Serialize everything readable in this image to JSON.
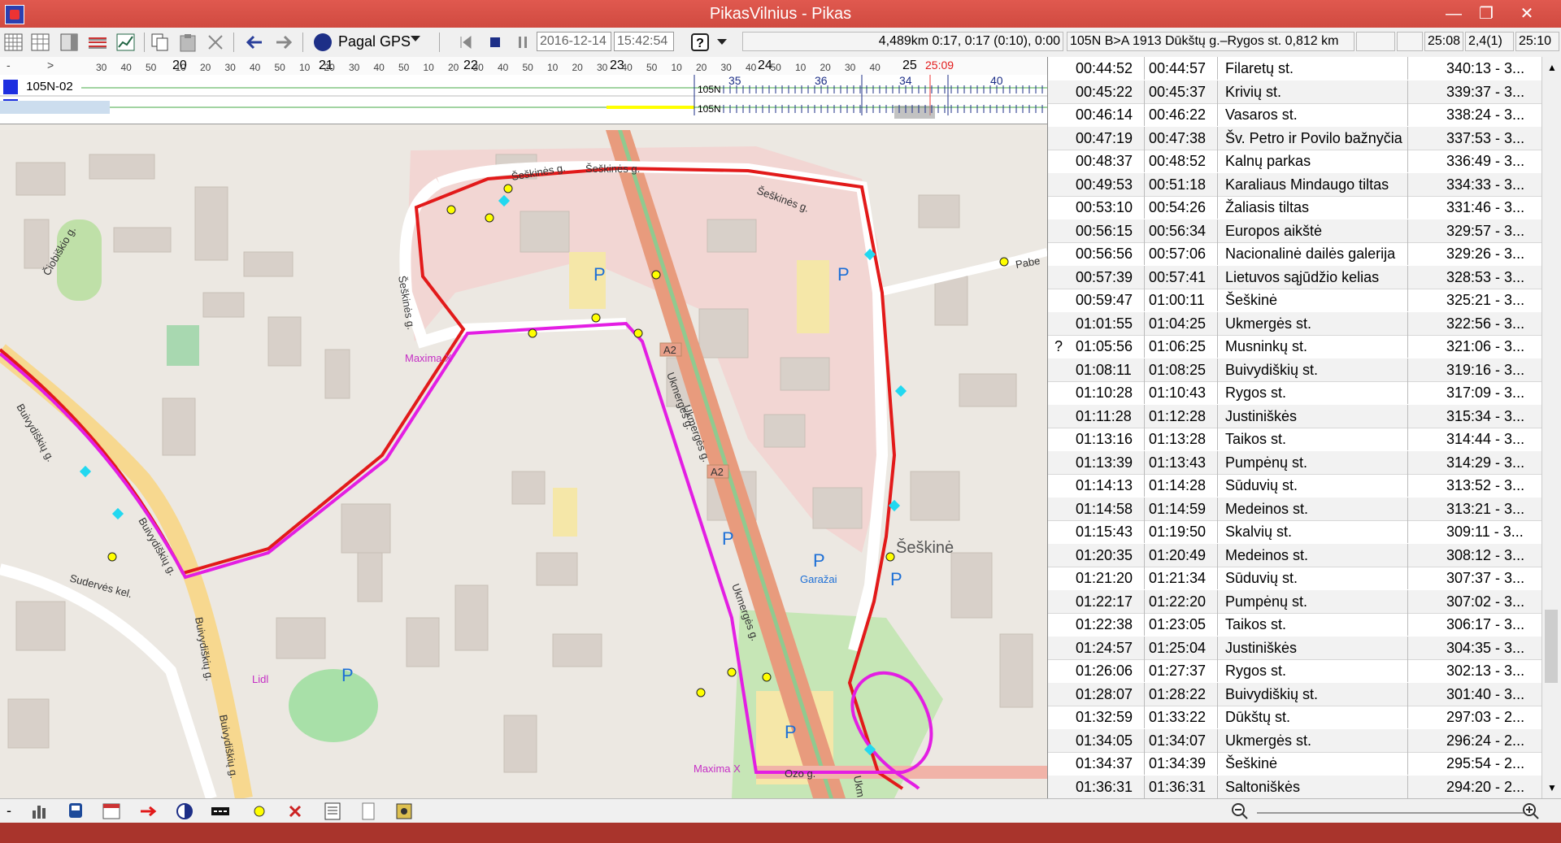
{
  "window": {
    "title": "PikasVilnius - Pikas"
  },
  "toolbar": {
    "gps_label": "Pagal GPS",
    "date": "2016-12-14",
    "time": "15:42:54",
    "status_distance": "4,489km 0:17, 0:17 (0:10), 0:00",
    "status_route": "105N B>A 1913 Dūkštų g.–Rygos st. 0,812 km",
    "status_time1": "25:08",
    "status_value": "2,4(1)",
    "status_time2": "25:10"
  },
  "ruler": {
    "left_minus": "-",
    "left_arrow": ">",
    "hour_labels": [
      "20",
      "21",
      "22",
      "23",
      "24",
      "25"
    ],
    "minute_labels": [
      "30",
      "40",
      "50",
      "10",
      "20",
      "30",
      "40",
      "50",
      "10",
      "20",
      "30",
      "40",
      "50",
      "10",
      "20",
      "30",
      "40",
      "50",
      "10",
      "20",
      "30",
      "40",
      "50",
      "10",
      "20",
      "30",
      "40",
      "50",
      "10",
      "20",
      "30",
      "40"
    ],
    "current_time": "25:09"
  },
  "tracks": {
    "rows": [
      {
        "label": "105N-02",
        "tag": "105N"
      },
      {
        "label": "02",
        "tag": "105N"
      }
    ],
    "seg_labels": [
      "35",
      "36",
      "34",
      "40"
    ]
  },
  "map": {
    "streets": [
      "Šeškinės g.",
      "Šeškinės g.",
      "Šeškinės g.",
      "Šeškinės g.",
      "Ukmergės g.",
      "Ukmergės g.",
      "Ukmergės g.",
      "Buivydiškių g.",
      "Buivydiškių g.",
      "Buivydiškių g.",
      "Buivydiškių g.",
      "Sudervės kel.",
      "Čiobiškio g.",
      "Pabe",
      "Ozo g.",
      "Ukm"
    ],
    "road_badges": [
      "A2",
      "A2"
    ],
    "places": [
      "Maxima X",
      "Lidl",
      "Maxima X",
      "Garažai",
      "Šeškinė"
    ],
    "parking": "P",
    "colors": {
      "route_red": "#e21a1a",
      "route_magenta": "#e31ee3",
      "park_green": "#c8e6b4",
      "residential": "#f1d4d2"
    }
  },
  "table": {
    "rows": [
      {
        "flag": "",
        "arr": "00:44:52",
        "dep": "00:44:57",
        "stop": "Filaretų st.",
        "val": "340:13 - 3..."
      },
      {
        "flag": "",
        "arr": "00:45:22",
        "dep": "00:45:37",
        "stop": "Krivių st.",
        "val": "339:37 - 3..."
      },
      {
        "flag": "",
        "arr": "00:46:14",
        "dep": "00:46:22",
        "stop": "Vasaros st.",
        "val": "338:24 - 3..."
      },
      {
        "flag": "",
        "arr": "00:47:19",
        "dep": "00:47:38",
        "stop": "Šv. Petro ir Povilo bažnyčia",
        "val": "337:53 - 3..."
      },
      {
        "flag": "",
        "arr": "00:48:37",
        "dep": "00:48:52",
        "stop": "Kalnų parkas",
        "val": "336:49 - 3..."
      },
      {
        "flag": "",
        "arr": "00:49:53",
        "dep": "00:51:18",
        "stop": "Karaliaus Mindaugo tiltas",
        "val": "334:33 - 3..."
      },
      {
        "flag": "",
        "arr": "00:53:10",
        "dep": "00:54:26",
        "stop": "Žaliasis tiltas",
        "val": "331:46 - 3..."
      },
      {
        "flag": "",
        "arr": "00:56:15",
        "dep": "00:56:34",
        "stop": "Europos aikštė",
        "val": "329:57 - 3..."
      },
      {
        "flag": "",
        "arr": "00:56:56",
        "dep": "00:57:06",
        "stop": "Nacionalinė dailės galerija",
        "val": "329:26 - 3..."
      },
      {
        "flag": "",
        "arr": "00:57:39",
        "dep": "00:57:41",
        "stop": "Lietuvos sąjūdžio kelias",
        "val": "328:53 - 3..."
      },
      {
        "flag": "",
        "arr": "00:59:47",
        "dep": "01:00:11",
        "stop": "Šeškinė",
        "val": "325:21 - 3..."
      },
      {
        "flag": "",
        "arr": "01:01:55",
        "dep": "01:04:25",
        "stop": "Ukmergės st.",
        "val": "322:56 - 3..."
      },
      {
        "flag": "?",
        "arr": "01:05:56",
        "dep": "01:06:25",
        "stop": "Musninkų st.",
        "val": "321:06 - 3..."
      },
      {
        "flag": "",
        "arr": "01:08:11",
        "dep": "01:08:25",
        "stop": "Buivydiškių st.",
        "val": "319:16 - 3..."
      },
      {
        "flag": "",
        "arr": "01:10:28",
        "dep": "01:10:43",
        "stop": "Rygos st.",
        "val": "317:09 - 3..."
      },
      {
        "flag": "",
        "arr": "01:11:28",
        "dep": "01:12:28",
        "stop": "Justiniškės",
        "val": "315:34 - 3..."
      },
      {
        "flag": "",
        "arr": "01:13:16",
        "dep": "01:13:28",
        "stop": "Taikos st.",
        "val": "314:44 - 3..."
      },
      {
        "flag": "",
        "arr": "01:13:39",
        "dep": "01:13:43",
        "stop": "Pumpėnų st.",
        "val": "314:29 - 3..."
      },
      {
        "flag": "",
        "arr": "01:14:13",
        "dep": "01:14:28",
        "stop": "Sūduvių st.",
        "val": "313:52 - 3..."
      },
      {
        "flag": "",
        "arr": "01:14:58",
        "dep": "01:14:59",
        "stop": "Medeinos st.",
        "val": "313:21 - 3..."
      },
      {
        "flag": "",
        "arr": "01:15:43",
        "dep": "01:19:50",
        "stop": "Skalvių st.",
        "val": "309:11 - 3..."
      },
      {
        "flag": "",
        "arr": "01:20:35",
        "dep": "01:20:49",
        "stop": "Medeinos st.",
        "val": "308:12 - 3..."
      },
      {
        "flag": "",
        "arr": "01:21:20",
        "dep": "01:21:34",
        "stop": "Sūduvių st.",
        "val": "307:37 - 3..."
      },
      {
        "flag": "",
        "arr": "01:22:17",
        "dep": "01:22:20",
        "stop": "Pumpėnų st.",
        "val": "307:02 - 3..."
      },
      {
        "flag": "",
        "arr": "01:22:38",
        "dep": "01:23:05",
        "stop": "Taikos st.",
        "val": "306:17 - 3..."
      },
      {
        "flag": "",
        "arr": "01:24:57",
        "dep": "01:25:04",
        "stop": "Justiniškės",
        "val": "304:35 - 3..."
      },
      {
        "flag": "",
        "arr": "01:26:06",
        "dep": "01:27:37",
        "stop": "Rygos st.",
        "val": "302:13 - 3..."
      },
      {
        "flag": "",
        "arr": "01:28:07",
        "dep": "01:28:22",
        "stop": "Buivydiškių st.",
        "val": "301:40 - 3..."
      },
      {
        "flag": "",
        "arr": "01:32:59",
        "dep": "01:33:22",
        "stop": "Dūkštų st.",
        "val": "297:03 - 2..."
      },
      {
        "flag": "",
        "arr": "01:34:05",
        "dep": "01:34:07",
        "stop": "Ukmergės st.",
        "val": "296:24 - 2..."
      },
      {
        "flag": "",
        "arr": "01:34:37",
        "dep": "01:34:39",
        "stop": "Šeškinė",
        "val": "295:54 - 2..."
      },
      {
        "flag": "",
        "arr": "01:36:31",
        "dep": "01:36:31",
        "stop": "Saltoniškės",
        "val": "294:20 - 2..."
      }
    ]
  },
  "bottombar": {
    "minus": "-"
  }
}
